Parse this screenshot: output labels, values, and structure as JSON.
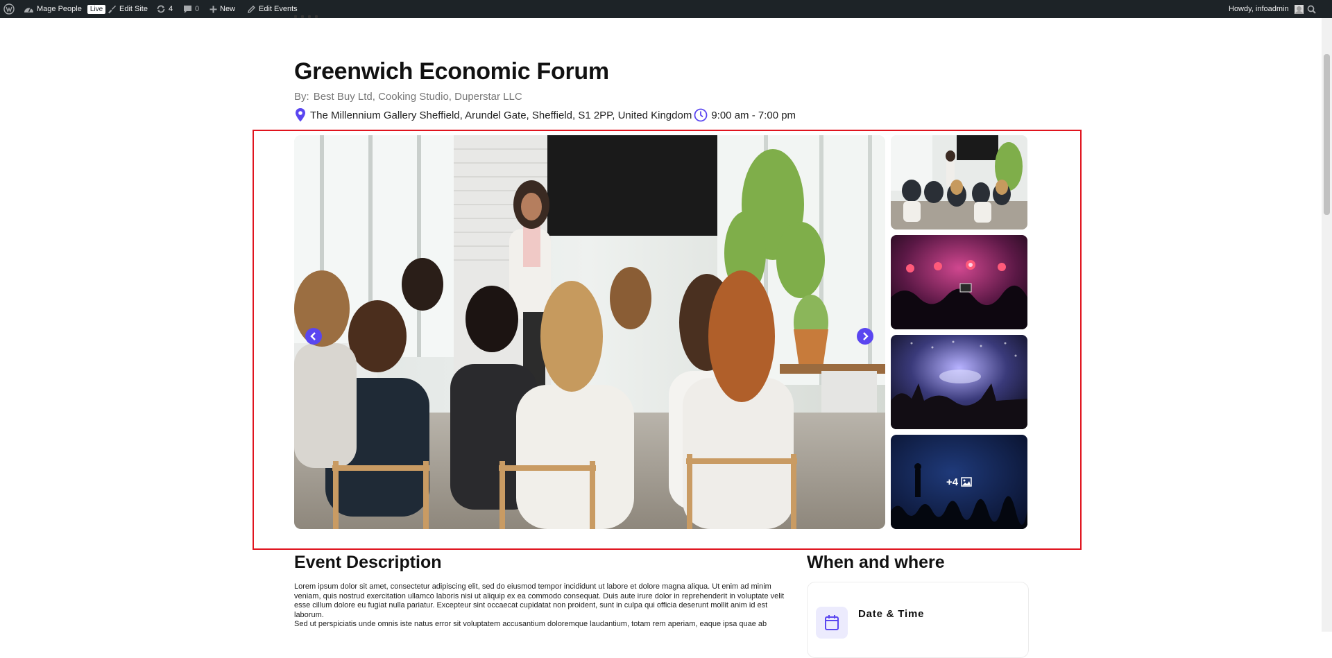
{
  "admin_bar": {
    "site_name": "Mage People",
    "live_badge": "Live",
    "edit_site": "Edit Site",
    "updates_count": "4",
    "comments_count": "0",
    "new_label": "New",
    "edit_events": "Edit Events",
    "greeting": "Howdy, infoadmin"
  },
  "event": {
    "title": "Greenwich Economic Forum",
    "by_label": "By:",
    "organizers": "Best Buy Ltd, Cooking Studio, Duperstar LLC",
    "location": "The Millennium Gallery Sheffield, Arundel Gate, Sheffield, S1 2PP, United Kingdom",
    "time": "9:00 am - 7:00 pm"
  },
  "gallery": {
    "more_count": "+4"
  },
  "description": {
    "heading": "Event Description",
    "paragraph_1": "Lorem ipsum dolor sit amet, consectetur adipiscing elit, sed do eiusmod tempor incididunt ut labore et dolore magna aliqua. Ut enim ad minim veniam, quis nostrud exercitation ullamco laboris nisi ut aliquip ex ea commodo consequat. Duis aute irure dolor in reprehenderit in voluptate velit esse cillum dolore eu fugiat nulla pariatur. Excepteur sint occaecat cupidatat non proident, sunt in culpa qui officia deserunt mollit anim id est laborum.",
    "paragraph_2": "Sed ut perspiciatis unde omnis iste natus error sit voluptatem accusantium doloremque laudantium, totam rem aperiam, eaque ipsa quae ab"
  },
  "when_where": {
    "heading": "When and where",
    "date_time_label": "Date & Time"
  },
  "colors": {
    "accent": "#5a46f0",
    "admin_bar": "#1d2327",
    "highlight_border": "#e0141e"
  }
}
